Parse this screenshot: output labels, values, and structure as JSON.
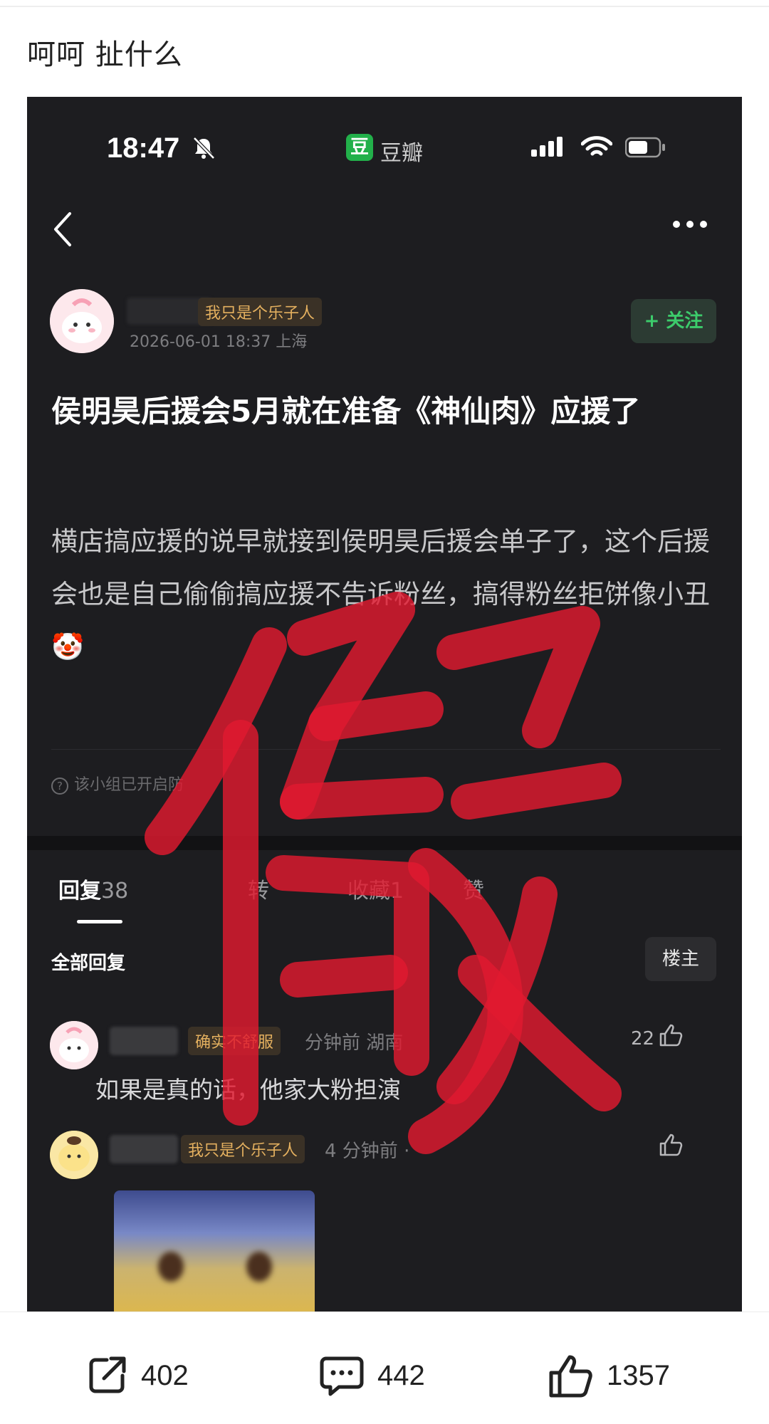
{
  "caption": "呵呵 扯什么",
  "phone": {
    "time": "18:47",
    "app_chip": "豆",
    "app_name": "豆瓣"
  },
  "post": {
    "author_badge": "我只是个乐子人",
    "timestamp": "2026-06-01 18:37 上海",
    "follow_label": "+ 关注",
    "title": "侯明昊后援会5月就在准备《神仙肉》应援了",
    "body": "横店搞应援的说早就接到侯明昊后援会单子了，这个后援会也是自己偷偷搞应援不告诉粉丝，搞得粉丝拒饼像小丑🤡",
    "notice": "该小组已开启防"
  },
  "tabs": [
    {
      "label": "回复",
      "count": "38"
    },
    {
      "label": "转"
    },
    {
      "label": "收藏",
      "count": "1"
    },
    {
      "label": "赞"
    }
  ],
  "replies_header": {
    "all_label": "全部回复",
    "op_label": "楼主"
  },
  "comments": [
    {
      "badge": "确实不舒服",
      "meta": "分钟前 湖南",
      "text": "如果是真的话，他家大粉担演",
      "likes": "22"
    },
    {
      "badge": "我只是个乐子人",
      "meta": "4 分钟前 ·"
    }
  ],
  "stamp_text": "假",
  "footer": {
    "share_count": "402",
    "comment_count": "442",
    "like_count": "1357"
  },
  "colors": {
    "stamp": "#e01a30",
    "screenshot_bg": "#1d1d20",
    "follow_green": "#3ccb6b",
    "badge_gold": "#e4b05f"
  },
  "icons": [
    "bell-mute-icon",
    "signal-icon",
    "wifi-icon",
    "battery-icon",
    "back-icon",
    "more-icon",
    "thumbs-up-icon",
    "share-icon",
    "comment-icon",
    "like-icon"
  ]
}
